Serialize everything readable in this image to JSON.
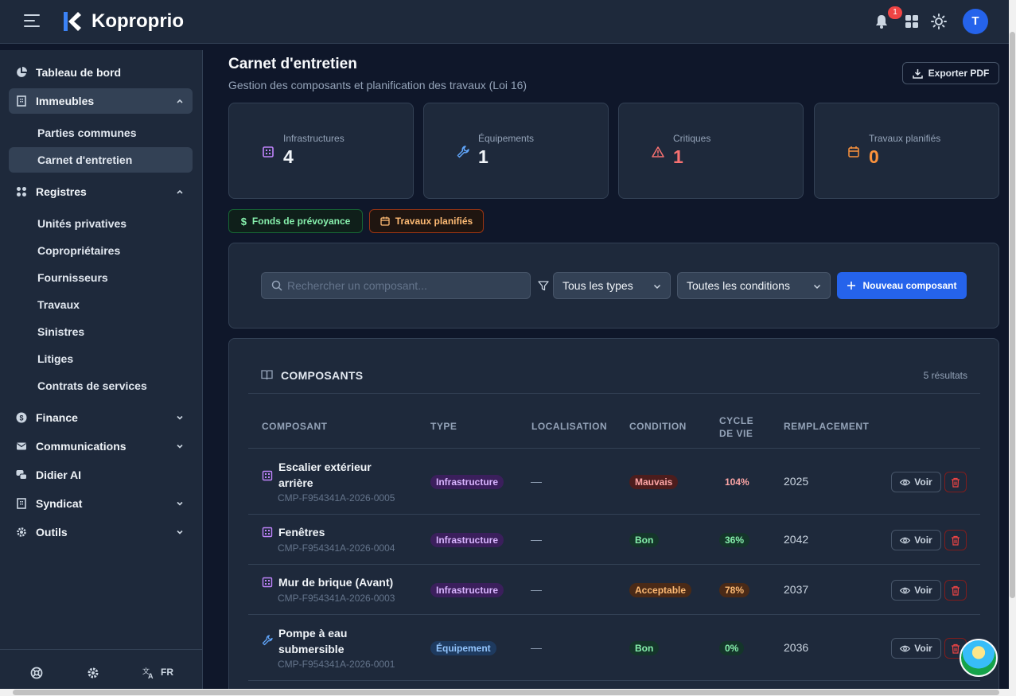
{
  "app": {
    "brand": "Koproprio"
  },
  "header": {
    "notifications_count": "1",
    "avatar_initial": "T"
  },
  "sidebar": {
    "dashboard": "Tableau de bord",
    "buildings": "Immeubles",
    "buildings_children": [
      "Parties communes",
      "Carnet d'entretien"
    ],
    "registers": "Registres",
    "registers_children": [
      "Unités privatives",
      "Copropriétaires",
      "Fournisseurs",
      "Travaux",
      "Sinistres",
      "Litiges",
      "Contrats de services"
    ],
    "finance": "Finance",
    "communications": "Communications",
    "didier": "Didier AI",
    "syndicat": "Syndicat",
    "tools": "Outils",
    "language": "FR"
  },
  "page": {
    "title": "Carnet d'entretien",
    "subtitle": "Gestion des composants et planification des travaux (Loi 16)",
    "export_label": "Exporter PDF"
  },
  "stats": [
    {
      "label": "Infrastructures",
      "value": "4",
      "color": "#f1f5f9",
      "icon": "building-icon"
    },
    {
      "label": "Équipements",
      "value": "1",
      "color": "#f1f5f9",
      "icon": "wrench-icon"
    },
    {
      "label": "Critiques",
      "value": "1",
      "color": "#f87171",
      "icon": "warning-icon"
    },
    {
      "label": "Travaux planifiés",
      "value": "0",
      "color": "#fb923c",
      "icon": "calendar-icon"
    }
  ],
  "quick_links": {
    "fund": "Fonds de prévoyance",
    "planned": "Travaux planifiés"
  },
  "filters": {
    "search_placeholder": "Rechercher un composant...",
    "type_select": "Tous les types",
    "condition_select": "Toutes les conditions",
    "new_button": "Nouveau composant"
  },
  "table": {
    "title": "COMPOSANTS",
    "count": "5 résultats",
    "columns": [
      "COMPOSANT",
      "TYPE",
      "LOCALISATION",
      "CONDITION",
      "CYCLE",
      "DE VIE",
      "REMPLACEMENT"
    ],
    "view_label": "Voir",
    "rows": [
      {
        "name": "Escalier extérieur arrière",
        "code": "CMP-F954341A-2026-0005",
        "type": "Infrastructure",
        "location": "—",
        "condition": "Mauvais",
        "cycle": "104%",
        "replacement": "2025"
      },
      {
        "name": "Fenêtres",
        "code": "CMP-F954341A-2026-0004",
        "type": "Infrastructure",
        "location": "—",
        "condition": "Bon",
        "cycle": "36%",
        "replacement": "2042"
      },
      {
        "name": "Mur de brique (Avant)",
        "code": "CMP-F954341A-2026-0003",
        "type": "Infrastructure",
        "location": "—",
        "condition": "Acceptable",
        "cycle": "78%",
        "replacement": "2037"
      },
      {
        "name": "Pompe à eau submersible",
        "code": "CMP-F954341A-2026-0001",
        "type": "Équipement",
        "location": "—",
        "condition": "Bon",
        "cycle": "0%",
        "replacement": "2036"
      }
    ]
  }
}
